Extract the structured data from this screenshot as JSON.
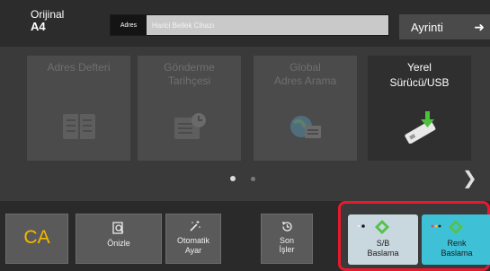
{
  "header": {
    "original_label": "Orijinal",
    "original_size": "A4",
    "address_label": "Adres",
    "address_placeholder": "Harici Bellek Cihazı",
    "detail_label": "Ayrinti"
  },
  "tiles": [
    {
      "line1": "Adres Defteri",
      "line2": "",
      "active": false
    },
    {
      "line1": "Gönderme Tarihçesi",
      "line2": "",
      "active": false
    },
    {
      "line1": "Global",
      "line2": "Adres Arama",
      "active": false
    },
    {
      "line1": "Yerel",
      "line2": "Sürücü/USB",
      "active": true
    }
  ],
  "bottom": {
    "ca_label": "CA",
    "preview_label": "Önizle",
    "auto_line1": "Otomatik",
    "auto_line2": "Ayar",
    "last_line1": "Son",
    "last_line2": "İşler",
    "bw_line1": "S/B",
    "bw_line2": "Baslama",
    "color_line1": "Renk",
    "color_line2": "Baslama"
  },
  "icons": {
    "tile1": "address-book-icon",
    "tile2": "send-history-icon",
    "tile3": "global-search-icon",
    "tile4": "usb-drive-icon",
    "detail": "arrow-right-icon",
    "next": "chevron-right-icon",
    "preview": "preview-icon",
    "auto": "magic-wand-icon",
    "last": "history-icon",
    "start": "diamond-start-icon"
  },
  "colors": {
    "accent_start_color": "#3ec1d6",
    "accent_start_bw": "#c9d7de",
    "ca_text": "#f5b800",
    "highlight_border": "#e8192c",
    "diamond_green": "#54c24a"
  },
  "pagination": {
    "current": 1,
    "total": 2
  }
}
